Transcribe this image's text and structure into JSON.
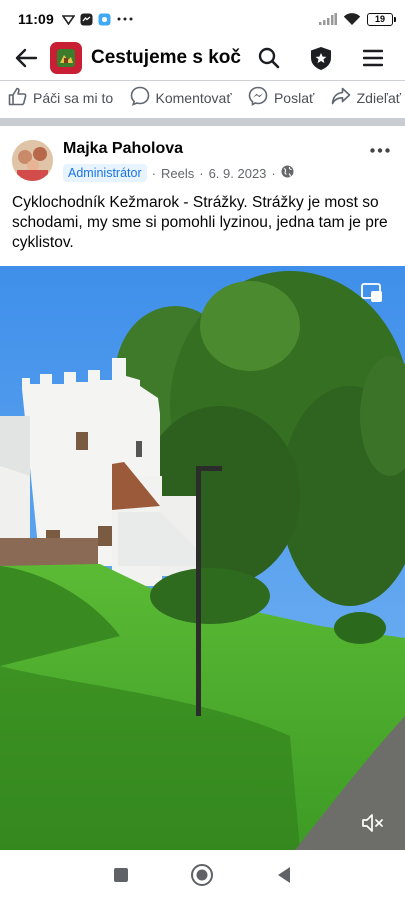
{
  "status_bar": {
    "time": "11:09",
    "battery": "19",
    "icons": [
      "signal-icon",
      "wifi-icon",
      "battery-icon"
    ]
  },
  "header": {
    "group_title": "Cestujeme s koč…",
    "icons": [
      "back-arrow-icon",
      "search-icon",
      "admin-shield-icon",
      "menu-icon"
    ]
  },
  "actions": {
    "like": "Páči sa mi to",
    "comment": "Komentovať",
    "send": "Poslať",
    "share": "Zdieľať"
  },
  "post": {
    "author": "Majka Paholova",
    "role": "Administrátor",
    "source": "Reels",
    "date": "6. 9. 2023",
    "text": "Cyklochodník Kežmarok - Strážky. Strážky je most so schodami, my sme si pomohli lyzinou, jedna tam je pre cyklistov."
  },
  "colors": {
    "accent": "#1b74e4",
    "group_avatar": "#c81f35",
    "sky": "#4f9df0",
    "grass": "#4fb32f"
  }
}
